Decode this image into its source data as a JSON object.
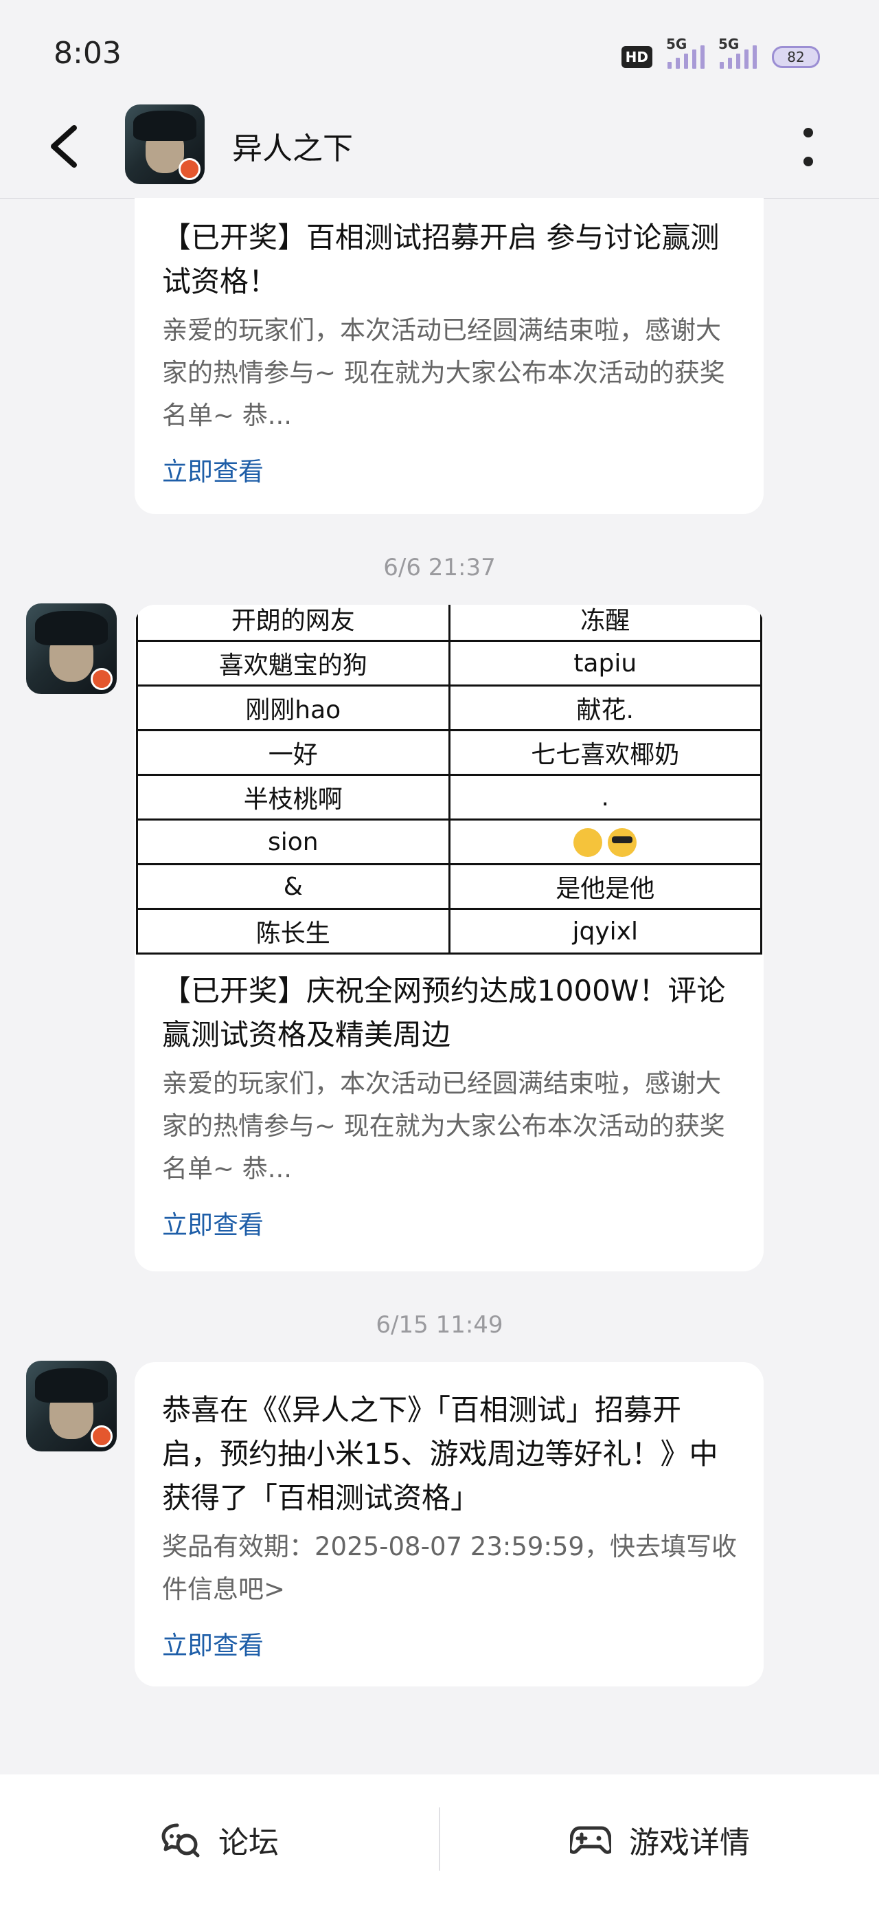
{
  "status": {
    "time": "8:03",
    "hd": "HD",
    "net1": "5G",
    "net2": "5G",
    "battery": "82"
  },
  "header": {
    "title": "异人之下"
  },
  "cards": [
    {
      "title": "【已开奖】百相测试招募开启 参与讨论赢测试资格！",
      "desc": "亲爱的玩家们，本次活动已经圆满结束啦，感谢大家的热情参与~ 现在就为大家公布本次活动的获奖名单~ 恭...",
      "link": "立即查看"
    },
    {
      "timestamp": "6/6  21:37",
      "table": [
        [
          "开朗的网友",
          "冻醒"
        ],
        [
          "喜欢魈宝的狗",
          "tapiu"
        ],
        [
          "刚刚hao",
          "献花."
        ],
        [
          "一好",
          "七七喜欢椰奶"
        ],
        [
          "半枝桃啊",
          "."
        ],
        [
          "sion",
          ""
        ],
        [
          "&",
          "是他是他"
        ],
        [
          "陈长生",
          "jqyixl"
        ]
      ],
      "title": "【已开奖】庆祝全网预约达成1000W！评论赢测试资格及精美周边",
      "desc": "亲爱的玩家们，本次活动已经圆满结束啦，感谢大家的热情参与~ 现在就为大家公布本次活动的获奖名单~ 恭...",
      "link": "立即查看"
    },
    {
      "timestamp": "6/15  11:49",
      "title": "恭喜在《《异人之下》「百相测试」招募开启，预约抽小米15、游戏周边等好礼！》中获得了「百相测试资格」",
      "desc": "奖品有效期：2025-08-07 23:59:59，快去填写收件信息吧>",
      "link": "立即查看"
    }
  ],
  "bottom": {
    "forum": "论坛",
    "game_detail": "游戏详情"
  }
}
